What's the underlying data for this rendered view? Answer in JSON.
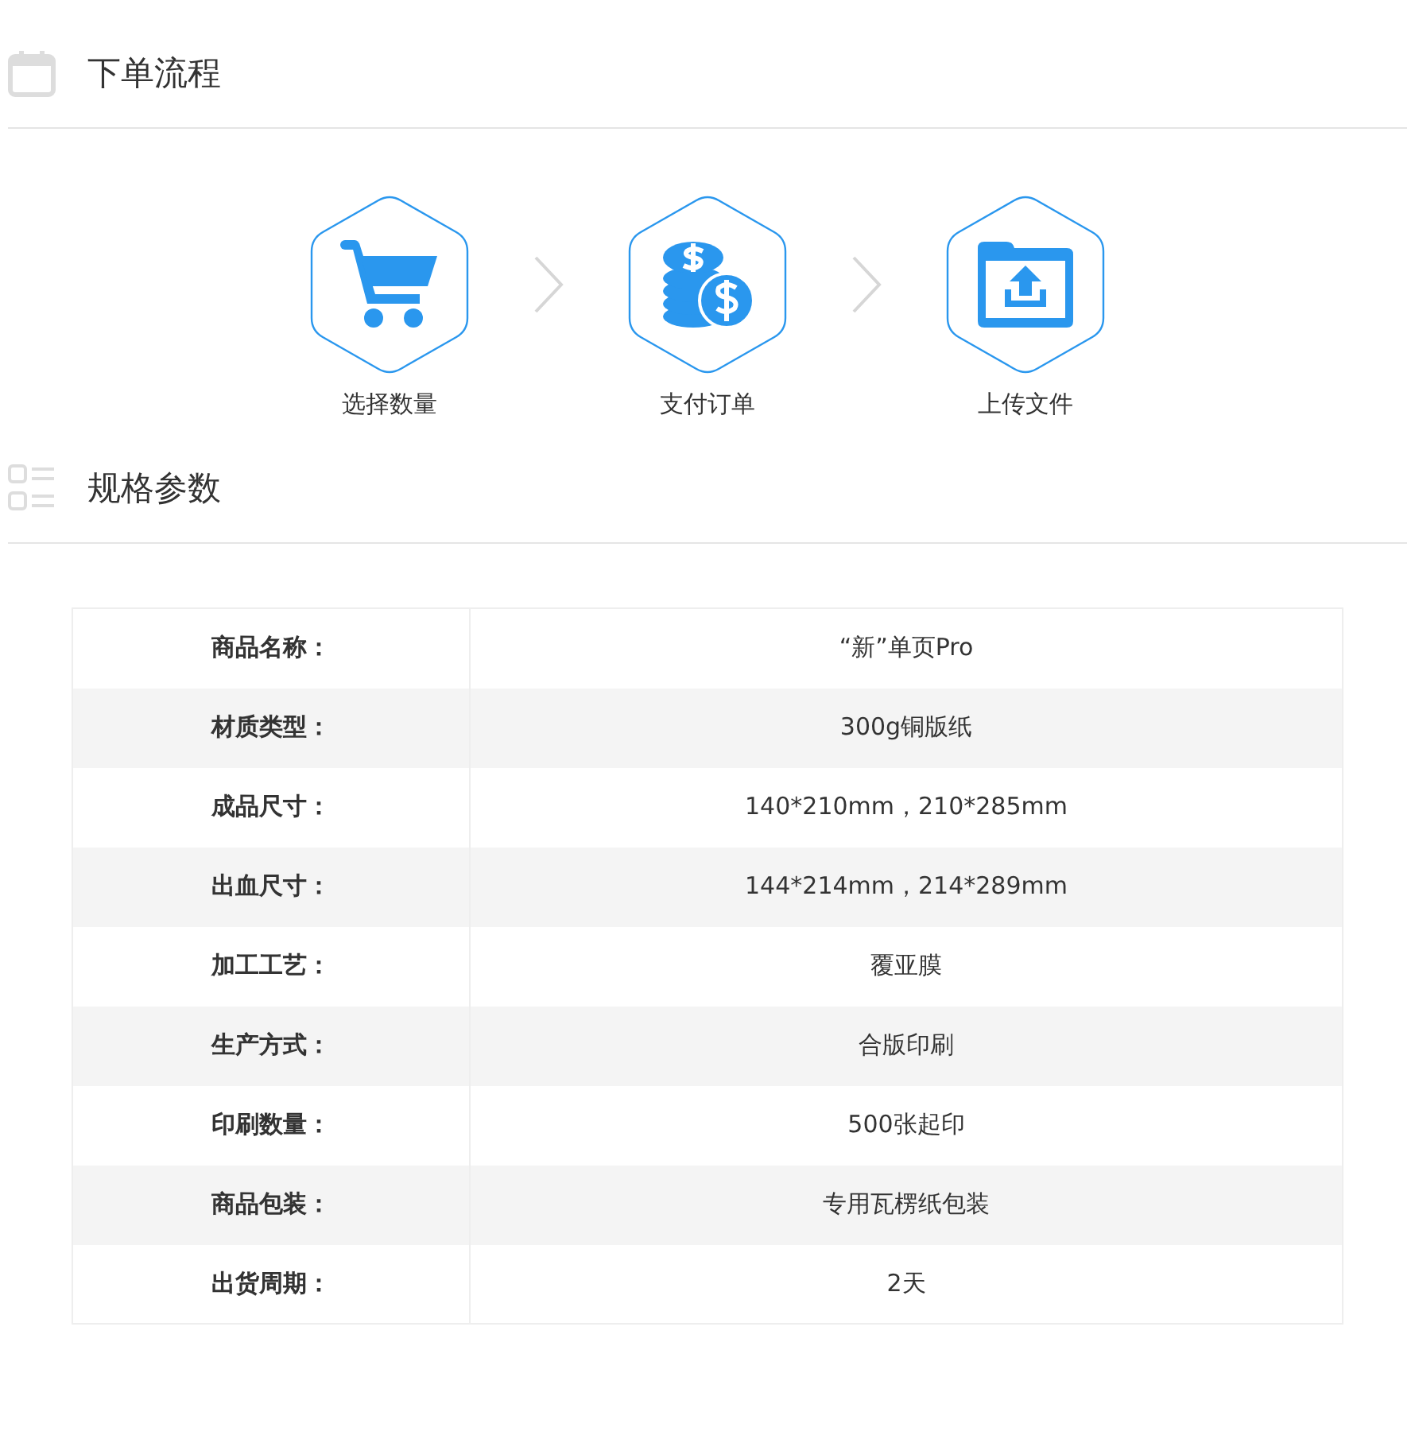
{
  "sections": [
    {
      "title": "下单流程",
      "kind": "calendar"
    },
    {
      "title": "规格参数",
      "kind": "list"
    }
  ],
  "steps": [
    {
      "label": "选择数量",
      "kind": "cart"
    },
    {
      "label": "支付订单",
      "kind": "coins"
    },
    {
      "label": "上传文件",
      "kind": "upload"
    }
  ],
  "specs": [
    {
      "label": "商品名称：",
      "value": "“新”单页Pro"
    },
    {
      "label": "材质类型：",
      "value": "300g铜版纸"
    },
    {
      "label": "成品尺寸：",
      "value": "140*210mm，210*285mm"
    },
    {
      "label": "出血尺寸：",
      "value": "144*214mm，214*289mm"
    },
    {
      "label": "加工工艺：",
      "value": "覆亚膜"
    },
    {
      "label": "生产方式：",
      "value": "合版印刷"
    },
    {
      "label": "印刷数量：",
      "value": "500张起印"
    },
    {
      "label": "商品包装：",
      "value": "专用瓦楞纸包装"
    },
    {
      "label": "出货周期：",
      "value": "2天"
    }
  ]
}
